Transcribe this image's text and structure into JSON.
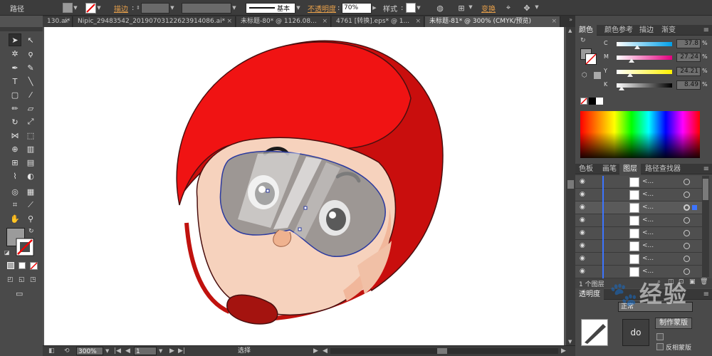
{
  "controlbar": {
    "object_type": "路径",
    "stroke_label": "描边",
    "stroke_profile": "基本",
    "opacity_label": "不透明度",
    "opacity_value": "70%",
    "style_label": "样式",
    "transform_label": "变换"
  },
  "tabs": [
    {
      "label": "130.ai*"
    },
    {
      "label": "Nipic_29483542_20190703122623914086.ai*"
    },
    {
      "label": "未标题-80* @ 1126.08..."
    },
    {
      "label": "4761 [转换].eps* @ 1..."
    },
    {
      "label": "未标题-81* @ 300% (CMYK/预览)"
    }
  ],
  "statusbar": {
    "zoom": "300%",
    "page": "1",
    "tool": "选择"
  },
  "color_panel": {
    "tabs": [
      "颜色",
      "颜色参考",
      "描边",
      "渐变"
    ],
    "channels": [
      {
        "name": "C",
        "value": "37.8",
        "knob": 0.38,
        "gradient": "linear-gradient(to right,#fff,#00a0e9)"
      },
      {
        "name": "M",
        "value": "27.24",
        "knob": 0.27,
        "gradient": "linear-gradient(to right,#fff,#e4007f)"
      },
      {
        "name": "Y",
        "value": "24.21",
        "knob": 0.24,
        "gradient": "linear-gradient(to right,#fff,#fff100)"
      },
      {
        "name": "K",
        "value": "8.49",
        "knob": 0.08,
        "gradient": "linear-gradient(to right,#fff,#000)"
      }
    ],
    "percent_sign": "%"
  },
  "layers_panel": {
    "tabs": [
      "色板",
      "画笔",
      "图层",
      "路径查找器"
    ],
    "layers": [
      {
        "name": "<..."
      },
      {
        "name": "<..."
      },
      {
        "name": "<..."
      },
      {
        "name": "<..."
      },
      {
        "name": "<..."
      },
      {
        "name": "<..."
      },
      {
        "name": "<..."
      },
      {
        "name": "<..."
      }
    ],
    "footer": "1 个图层"
  },
  "transparency_panel": {
    "title": "透明度",
    "mode_label": "正常",
    "make_mask": "制作蒙版",
    "invert_mask": "反相蒙版"
  },
  "watermark": {
    "text": "经验"
  },
  "colors": {
    "helmet": "#f01010",
    "helmet_dark": "#c80c0c",
    "skin": "#f6d2bd",
    "goggle": "#8e8e8e",
    "path_select": "#2b3aa0"
  }
}
